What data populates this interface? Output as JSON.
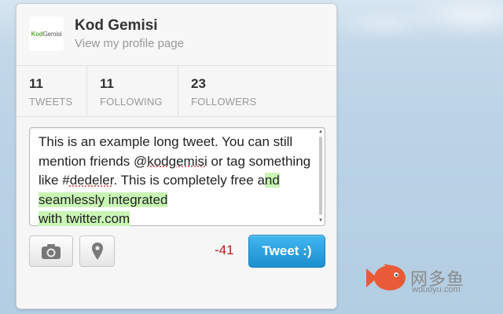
{
  "profile": {
    "avatar_logo_part1": "Kod",
    "avatar_logo_part2": "Gemisi",
    "name": "Kod Gemisi",
    "link_text": "View my profile page"
  },
  "stats": [
    {
      "value": "11",
      "label": "TWEETS"
    },
    {
      "value": "11",
      "label": "FOLLOWING"
    },
    {
      "value": "23",
      "label": "FOLLOWERS"
    }
  ],
  "compose": {
    "segments": {
      "s1": "This is an example long tweet. You can still mention friends @",
      "mention": "kodgemisi",
      "s2": " or tag something like #",
      "hashtag": "dedeler",
      "s3": ". This is completely free a",
      "overflow1": "nd seamlessly integrated ",
      "overflow2": "with twitter.com"
    }
  },
  "actions": {
    "camera_icon": "camera-icon",
    "location_icon": "location-pin-icon",
    "char_count": "-41",
    "tweet_label": "Tweet :)"
  },
  "watermark": {
    "title": "网多鱼",
    "subtitle": "wduoyu.com"
  },
  "colors": {
    "tweet_button": "#1d8fd0",
    "char_count": "#b22222",
    "overflow_highlight": "#c9f5b5",
    "brand_green": "#5aab3a"
  }
}
